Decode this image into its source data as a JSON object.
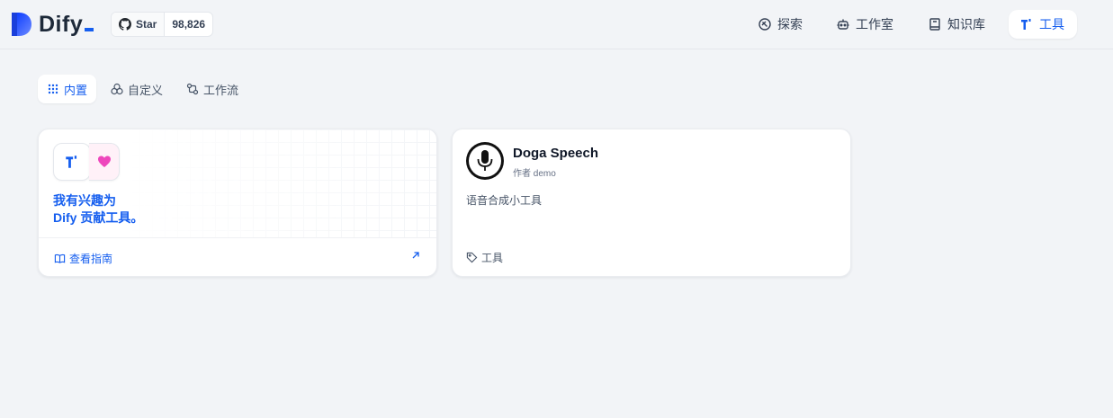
{
  "brand": {
    "name": "Dify",
    "accent": "#155eef"
  },
  "github": {
    "star_label": "Star",
    "count": "98,826"
  },
  "nav": {
    "explore": "探索",
    "studio": "工作室",
    "knowledge": "知识库",
    "tools": "工具",
    "active": "tools"
  },
  "subtabs": [
    {
      "label": "内置",
      "active": true,
      "icon": "grid-dots-icon"
    },
    {
      "label": "自定义",
      "active": false,
      "icon": "custom-icon"
    },
    {
      "label": "工作流",
      "active": false,
      "icon": "workflow-icon"
    }
  ],
  "contribute_card": {
    "title_line1": "我有兴趣为",
    "title_line2": "Dify 贡献工具。",
    "guide_label": "查看指南"
  },
  "tool_card": {
    "name": "Doga Speech",
    "author": "作者 demo",
    "description": "语音合成小工具",
    "tag": "工具",
    "icon": "microphone-icon"
  }
}
